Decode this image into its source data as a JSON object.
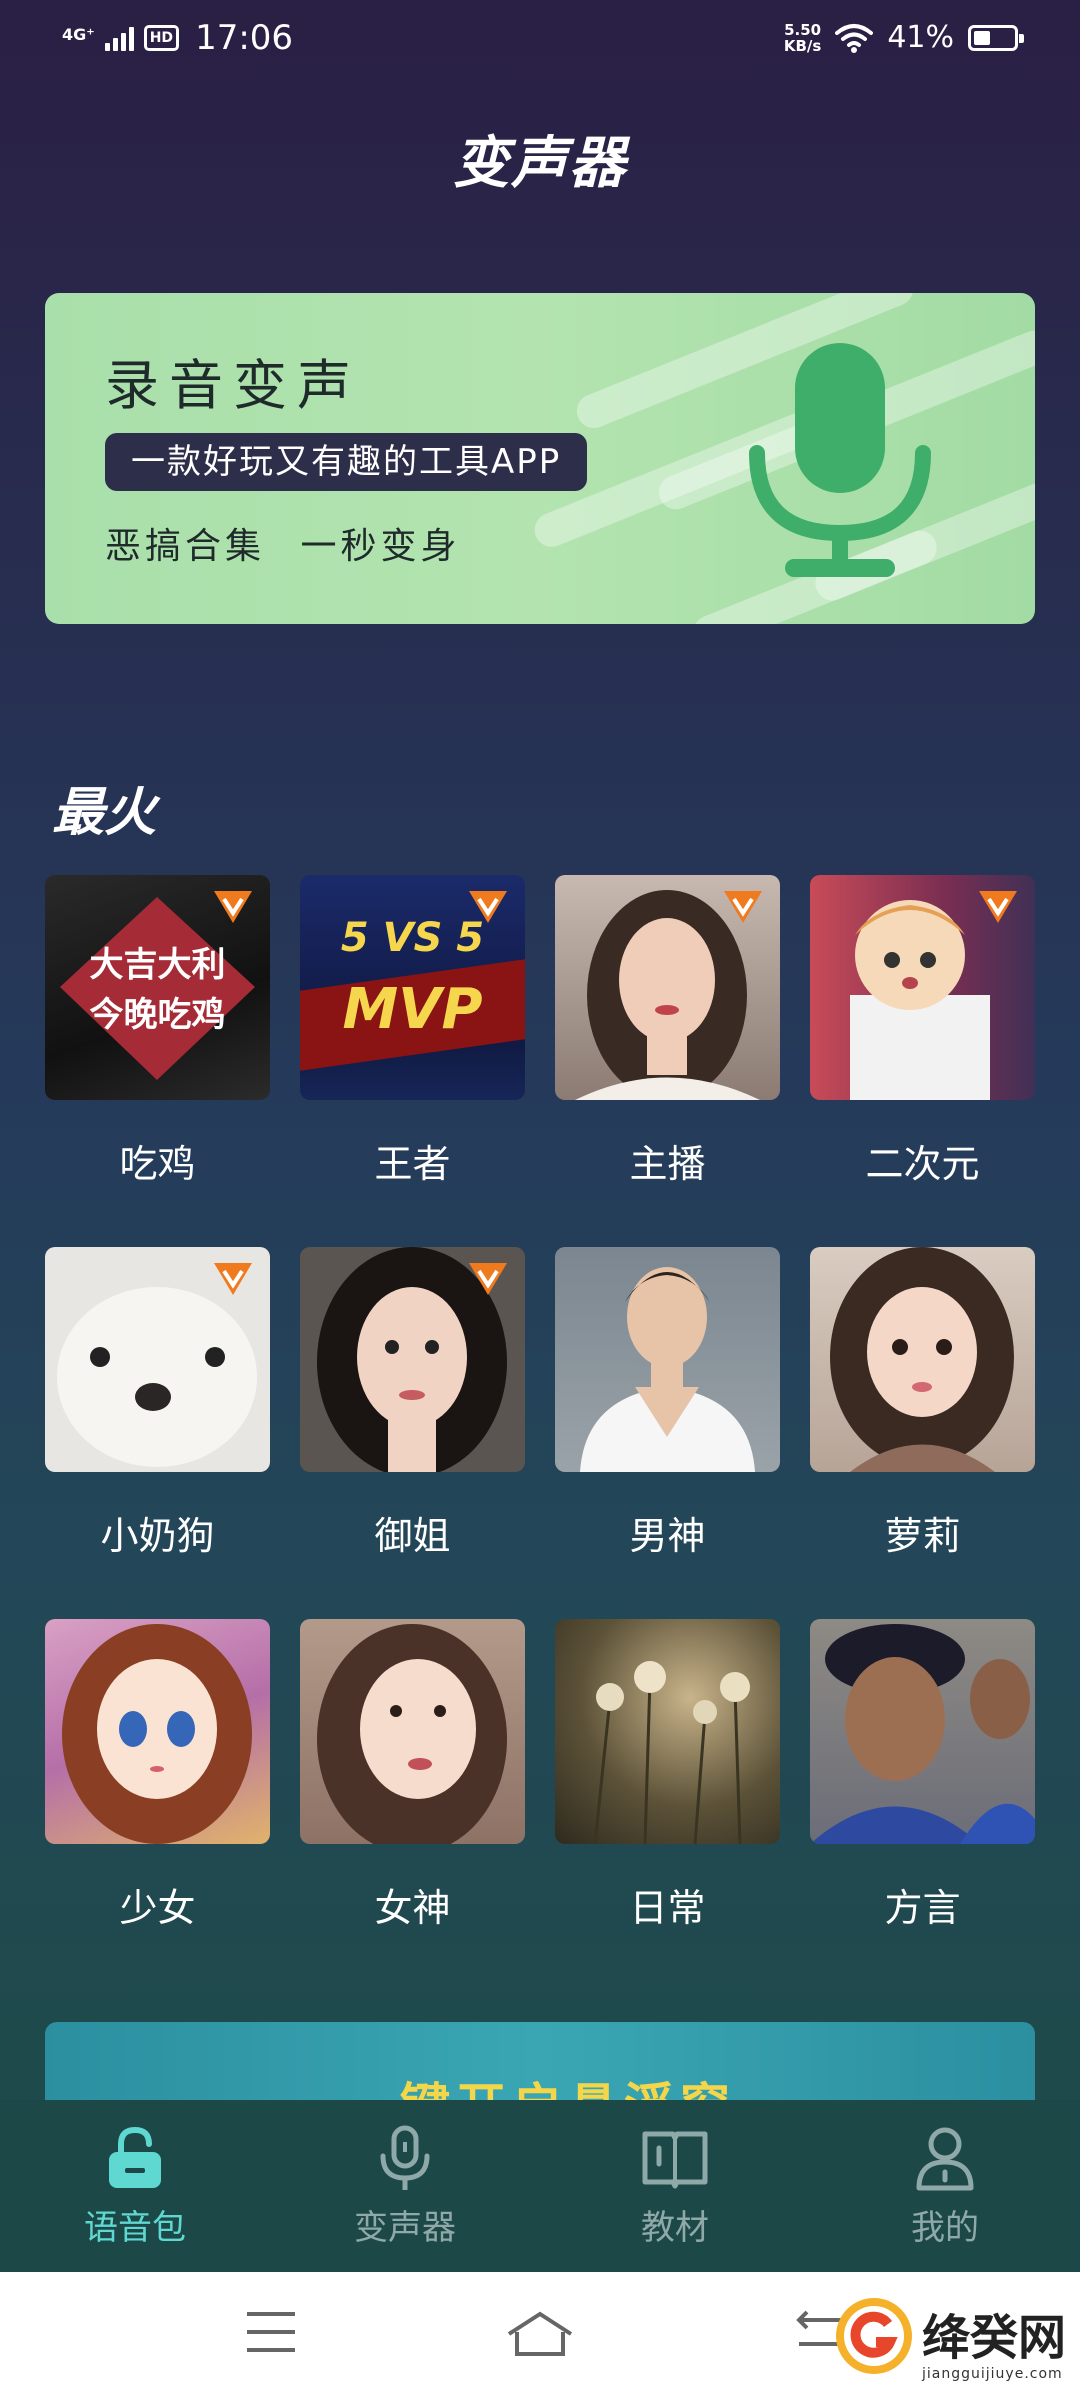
{
  "status_bar": {
    "network": "4G⁺",
    "hd": "HD",
    "time": "17:06",
    "speed_value": "5.50",
    "speed_unit": "KB/s",
    "battery": "41%",
    "battery_level": 0.41
  },
  "page_title": "变声器",
  "banner": {
    "title": "录音变声",
    "pill": "一款好玩又有趣的工具APP",
    "subtitle": "恶搞合集 一秒变身",
    "icon": "microphone-icon"
  },
  "section_title": "最火",
  "tiles": [
    {
      "label": "吃鸡",
      "vip": true,
      "art_lines": [
        "大吉大利",
        "今晚吃鸡"
      ]
    },
    {
      "label": "王者",
      "vip": true,
      "art_lines": [
        "5 VS 5",
        "MVP"
      ]
    },
    {
      "label": "主播",
      "vip": true
    },
    {
      "label": "二次元",
      "vip": true
    },
    {
      "label": "小奶狗",
      "vip": true
    },
    {
      "label": "御姐",
      "vip": true
    },
    {
      "label": "男神",
      "vip": false
    },
    {
      "label": "萝莉",
      "vip": false
    },
    {
      "label": "少女",
      "vip": false
    },
    {
      "label": "女神",
      "vip": false
    },
    {
      "label": "日常",
      "vip": false
    },
    {
      "label": "方言",
      "vip": false
    }
  ],
  "promo_banner": "一键开启悬浮窗",
  "tabs": [
    {
      "label": "语音包",
      "icon": "lock-bag-icon",
      "active": true
    },
    {
      "label": "变声器",
      "icon": "microphone-icon",
      "active": false
    },
    {
      "label": "教材",
      "icon": "book-icon",
      "active": false
    },
    {
      "label": "我的",
      "icon": "person-icon",
      "active": false
    }
  ],
  "watermark": {
    "text": "绛癸网",
    "url": "jiangguijiuye.com"
  },
  "colors": {
    "accent_teal": "#5fd8d2",
    "banner_green": "#a9dfaa",
    "vip_orange": "#f07a1e"
  }
}
